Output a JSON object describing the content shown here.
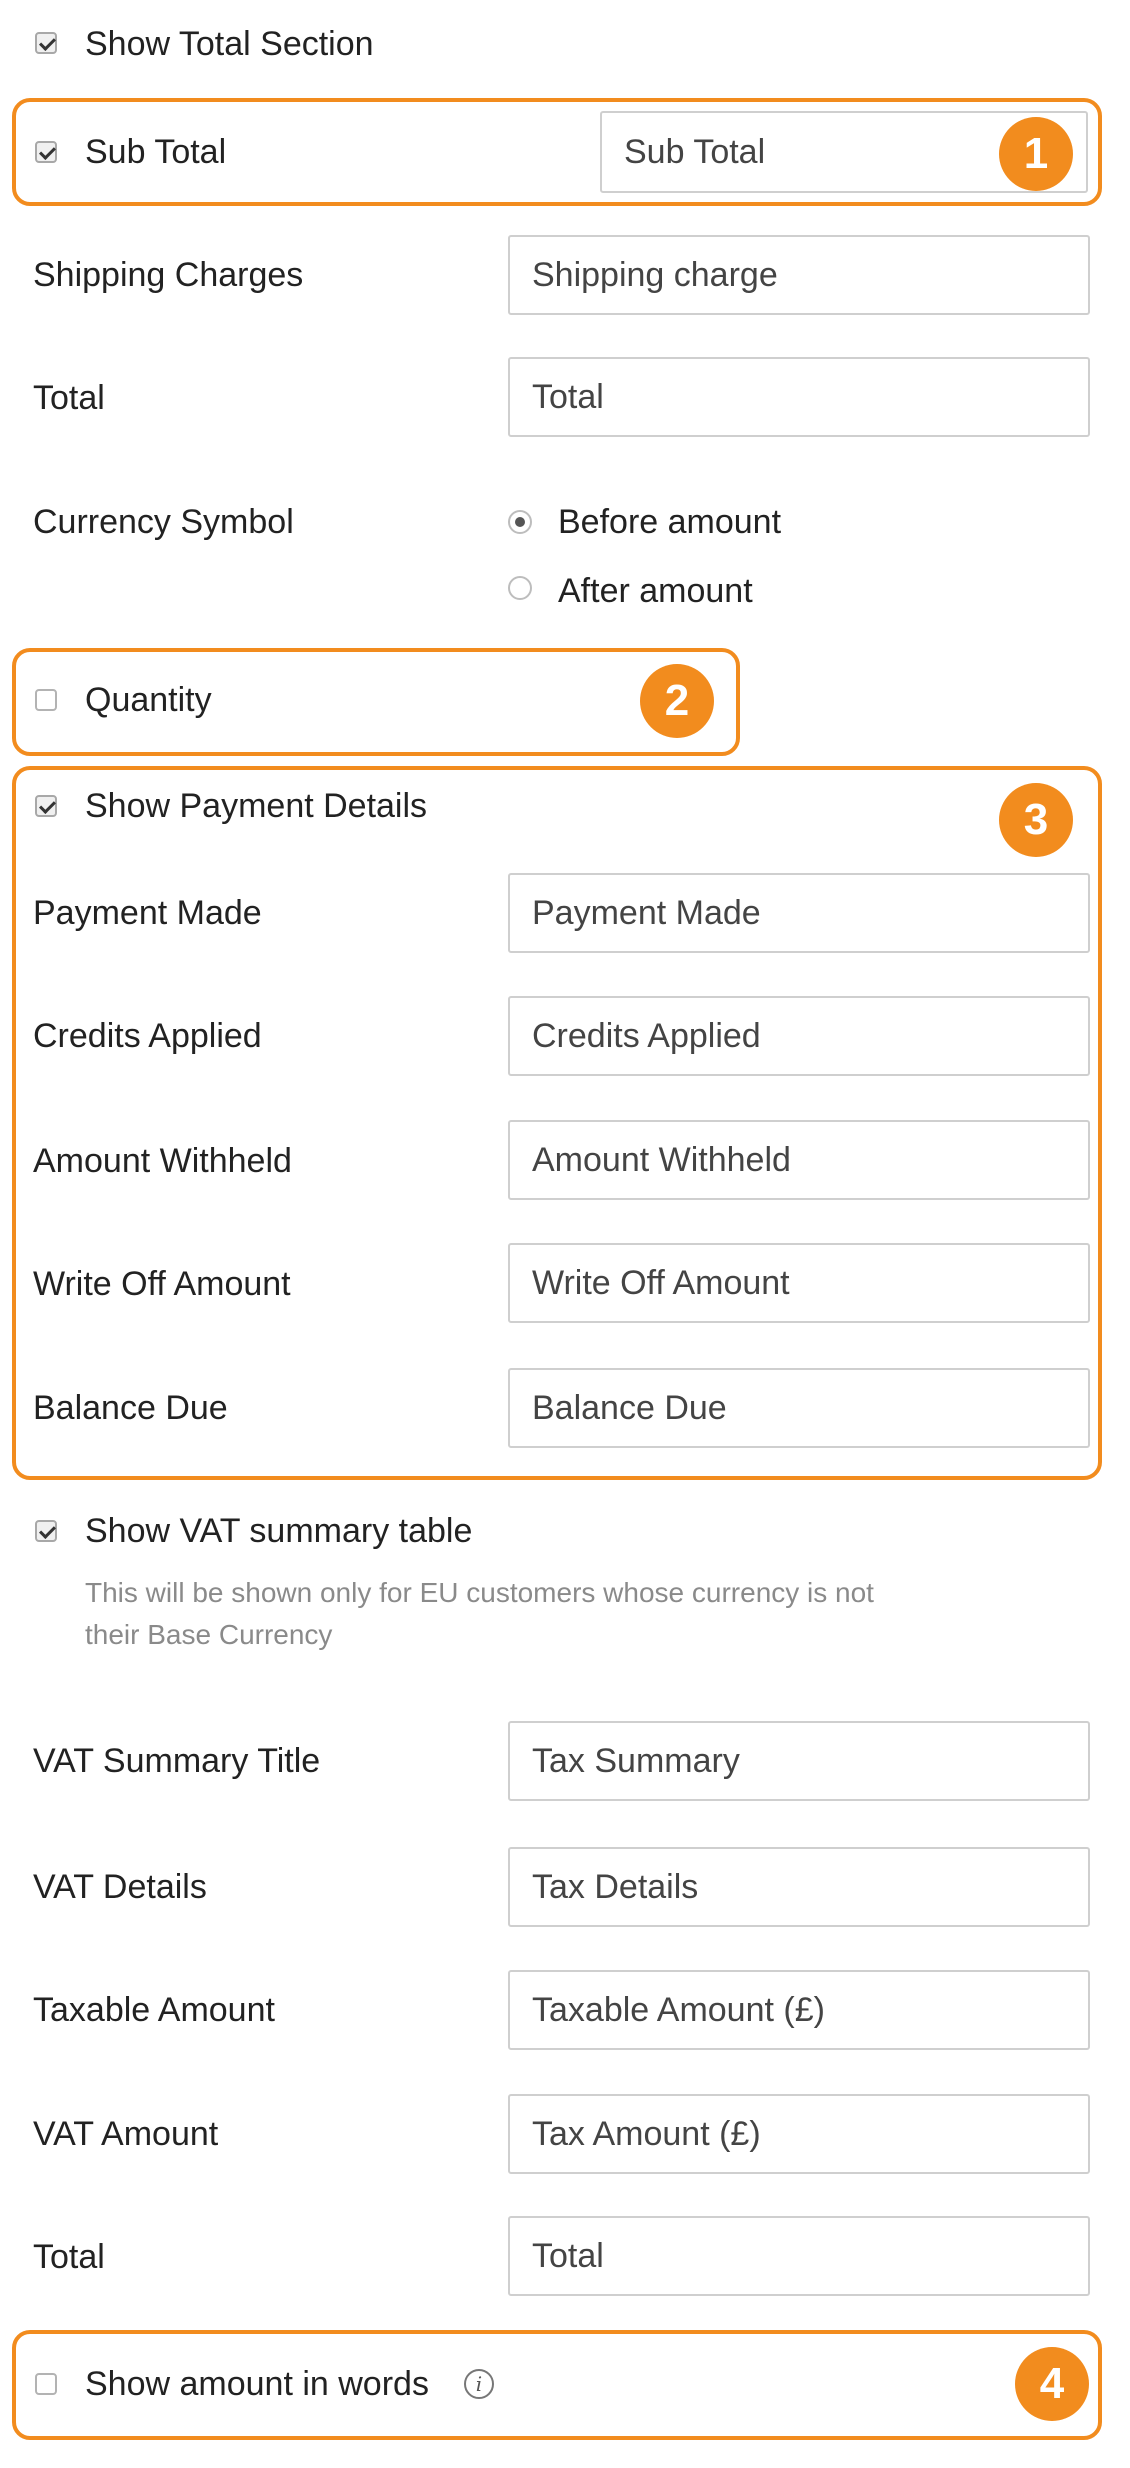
{
  "show_total_section": {
    "label": "Show Total Section",
    "checked": true
  },
  "sub_total": {
    "label": "Sub Total",
    "checked": true,
    "value": "Sub Total"
  },
  "shipping_charges": {
    "label": "Shipping Charges",
    "value": "Shipping charge"
  },
  "total_top": {
    "label": "Total",
    "value": "Total"
  },
  "currency_symbol": {
    "label": "Currency Symbol",
    "options": [
      "Before amount",
      "After amount"
    ],
    "selected": "Before amount"
  },
  "quantity": {
    "label": "Quantity",
    "checked": false
  },
  "payment_details": {
    "label": "Show Payment Details",
    "checked": true,
    "rows": [
      {
        "label": "Payment Made",
        "value": "Payment Made"
      },
      {
        "label": "Credits Applied",
        "value": "Credits Applied"
      },
      {
        "label": "Amount Withheld",
        "value": "Amount Withheld"
      },
      {
        "label": "Write Off Amount",
        "value": "Write Off Amount"
      },
      {
        "label": "Balance Due",
        "value": "Balance Due"
      }
    ]
  },
  "vat_summary": {
    "label": "Show VAT summary table",
    "checked": true,
    "hint_line1": "This will be shown only for EU customers whose currency is not",
    "hint_line2": "their Base Currency",
    "rows": [
      {
        "label": "VAT Summary Title",
        "value": "Tax Summary"
      },
      {
        "label": "VAT Details",
        "value": "Tax Details"
      },
      {
        "label": "Taxable Amount",
        "value": "Taxable Amount (£)"
      },
      {
        "label": "VAT Amount",
        "value": "Tax Amount (£)"
      },
      {
        "label": "Total",
        "value": "Total"
      }
    ]
  },
  "amount_in_words": {
    "label": "Show amount in words",
    "checked": false,
    "info_icon": "i"
  },
  "annotations": {
    "badge1": "1",
    "badge2": "2",
    "badge3": "3",
    "badge4": "4",
    "color": "#f28c1e"
  }
}
